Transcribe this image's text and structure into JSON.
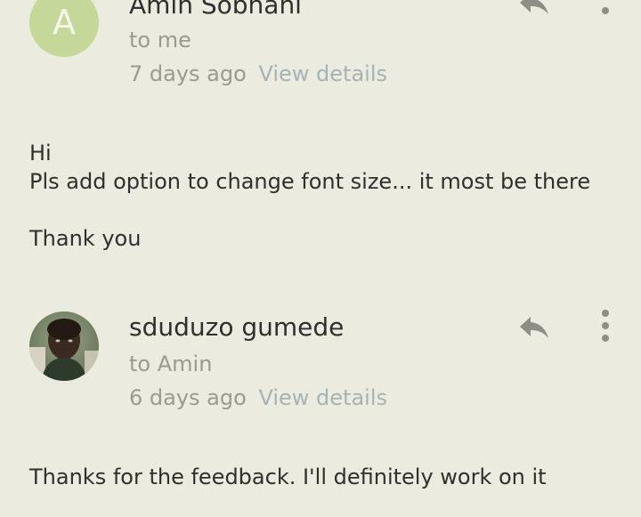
{
  "messages": [
    {
      "avatar_letter": "A",
      "sender": "Amin Sobhani",
      "recipient": "to me",
      "time": "7 days ago",
      "view_details": "View details",
      "body": {
        "greeting": "Hi",
        "line1": "Pls add option to change font size... it most be there",
        "closing": "Thank you"
      }
    },
    {
      "sender": "sduduzo gumede",
      "recipient": "to Amin",
      "time": "6 days ago",
      "view_details": "View details",
      "body": {
        "line1": "Thanks for the feedback. I'll definitely work on it"
      }
    }
  ],
  "colors": {
    "background": "#ecebdf",
    "avatar_letter_bg": "#c6d79a",
    "secondary_text": "#9a9a90",
    "link_text": "#a6b3b5",
    "icon": "#8e8e86"
  },
  "icons": [
    "reply-icon",
    "more-vert-icon"
  ]
}
